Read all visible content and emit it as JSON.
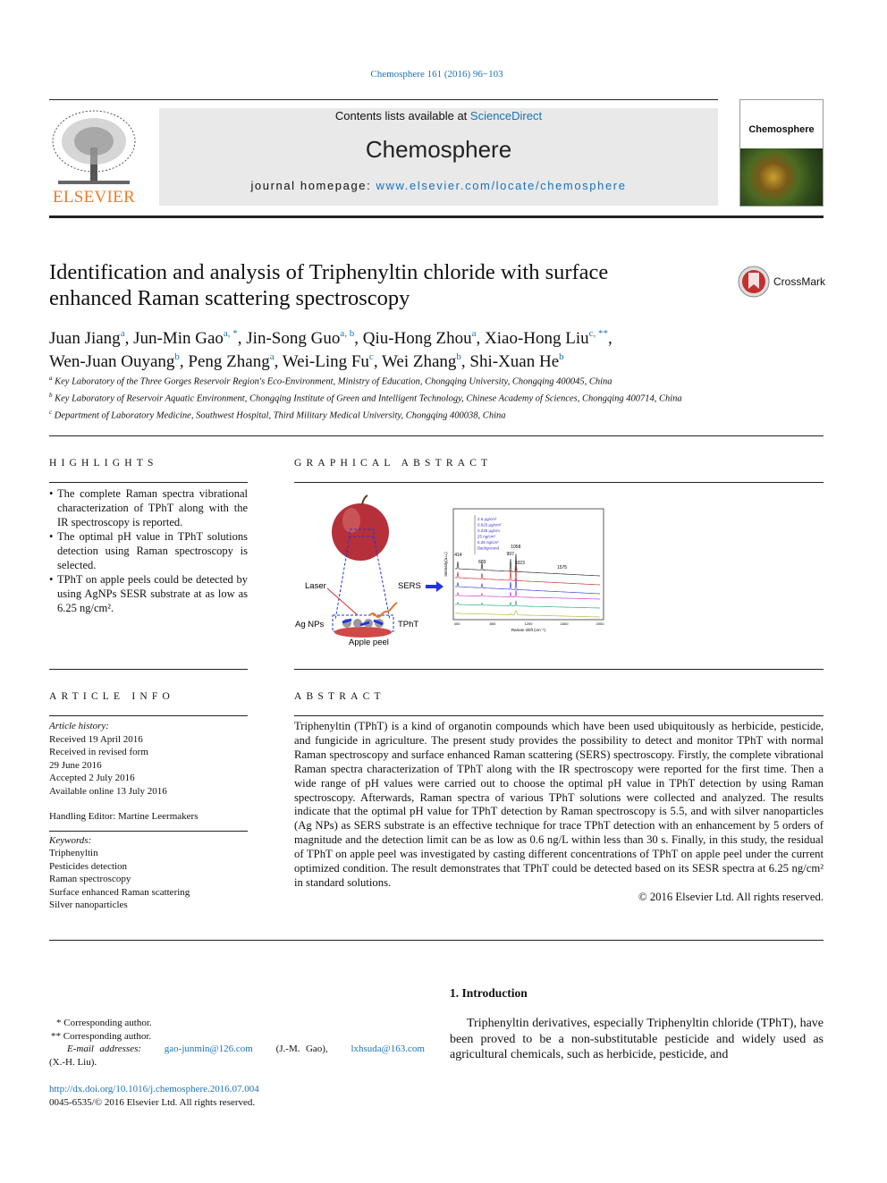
{
  "header": {
    "citation": "Chemosphere 161 (2016) 96−103",
    "contents_prefix": "Contents lists available at ",
    "contents_link": "ScienceDirect",
    "journal_title": "Chemosphere",
    "homepage_prefix": "journal homepage: ",
    "homepage_link": "www.elsevier.com/locate/chemosphere",
    "publisher": "ELSEVIER",
    "cover_title": "Chemosphere"
  },
  "crossmark": "CrossMark",
  "title": "Identification and analysis of Triphenyltin chloride with surface enhanced Raman scattering spectroscopy",
  "authors": [
    {
      "name": "Juan Jiang",
      "sup": "a"
    },
    {
      "name": "Jun-Min Gao",
      "sup": "a, *"
    },
    {
      "name": "Jin-Song Guo",
      "sup": "a, b"
    },
    {
      "name": "Qiu-Hong Zhou",
      "sup": "a"
    },
    {
      "name": "Xiao-Hong Liu",
      "sup": "c, **"
    },
    {
      "name": "Wen-Juan Ouyang",
      "sup": "b"
    },
    {
      "name": "Peng Zhang",
      "sup": "a"
    },
    {
      "name": "Wei-Ling Fu",
      "sup": "c"
    },
    {
      "name": "Wei Zhang",
      "sup": "b"
    },
    {
      "name": "Shi-Xuan He",
      "sup": "b"
    }
  ],
  "affiliations": [
    {
      "sup": "a",
      "text": "Key Laboratory of the Three Gorges Reservoir Region's Eco-Environment, Ministry of Education, Chongqing University, Chongqing 400045, China"
    },
    {
      "sup": "b",
      "text": "Key Laboratory of Reservoir Aquatic Environment, Chongqing Institute of Green and Intelligent Technology, Chinese Academy of Sciences, Chongqing 400714, China"
    },
    {
      "sup": "c",
      "text": "Department of Laboratory Medicine, Southwest Hospital, Third Military Medical University, Chongqing 400038, China"
    }
  ],
  "highlights": {
    "heading": "HIGHLIGHTS",
    "items": [
      "The complete Raman spectra vibrational characterization of TPhT along with the IR spectroscopy is reported.",
      "The optimal pH value in TPhT solutions detection using Raman spectroscopy is selected.",
      "TPhT on apple peels could be detected by using AgNPs SESR substrate at as low as 6.25 ng/cm²."
    ]
  },
  "graphical_abstract": {
    "heading": "GRAPHICAL ABSTRACT",
    "labels": {
      "laser": "Laser",
      "sers": "SERS",
      "agnps": "Ag NPs",
      "tpht": "TPhT",
      "peel": "Apple peel"
    },
    "spectrum": {
      "ylabel": "Intensity(a.u.)",
      "xlabel": "Raman shift (cm⁻¹)",
      "xticks": [
        "400",
        "800",
        "1200",
        "1600",
        "2000"
      ],
      "peaks": [
        "414",
        "683",
        "997",
        "1058",
        "1023",
        "1575"
      ],
      "legend": [
        "2.5 μg/cm²",
        "0.625 μg/cm²",
        "0.225 μg/cm",
        "25 ng/cm²",
        "6.25 ng/cm²",
        "Background"
      ],
      "colors": [
        "#333333",
        "#cc3333",
        "#4444dd",
        "#cc44cc",
        "#33aa88",
        "#bbbb44"
      ]
    }
  },
  "article_info": {
    "heading": "ARTICLE INFO",
    "history_label": "Article history:",
    "history": [
      "Received 19 April 2016",
      "Received in revised form",
      "29 June 2016",
      "Accepted 2 July 2016",
      "Available online 13 July 2016"
    ],
    "editor": "Handling Editor: Martine Leermakers",
    "keywords_label": "Keywords:",
    "keywords": [
      "Triphenyltin",
      "Pesticides detection",
      "Raman spectroscopy",
      "Surface enhanced Raman scattering",
      "Silver nanoparticles"
    ]
  },
  "abstract": {
    "heading": "ABSTRACT",
    "text": "Triphenyltin (TPhT) is a kind of organotin compounds which have been used ubiquitously as herbicide, pesticide, and fungicide in agriculture. The present study provides the possibility to detect and monitor TPhT with normal Raman spectroscopy and surface enhanced Raman scattering (SERS) spectroscopy. Firstly, the complete vibrational Raman spectra characterization of TPhT along with the IR spectroscopy were reported for the first time. Then a wide range of pH values were carried out to choose the optimal pH value in TPhT detection by using Raman spectroscopy. Afterwards, Raman spectra of various TPhT solutions were collected and analyzed. The results indicate that the optimal pH value for TPhT detection by Raman spectroscopy is 5.5, and with silver nanoparticles (Ag NPs) as SERS substrate is an effective technique for trace TPhT detection with an enhancement by 5 orders of magnitude and the detection limit can be as low as 0.6 ng/L within less than 30 s. Finally, in this study, the residual of TPhT on apple peel was investigated by casting different concentrations of TPhT on apple peel under the current optimized condition. The result demonstrates that TPhT could be detected based on its SESR spectra at 6.25 ng/cm² in standard solutions.",
    "copyright": "© 2016 Elsevier Ltd. All rights reserved."
  },
  "footnotes": {
    "corr1": "* Corresponding author.",
    "corr2": "** Corresponding author.",
    "email_label": "E-mail addresses:",
    "email1": "gao-junmin@126.com",
    "who1": "(J.-M. Gao),",
    "email2": "lxhsuda@163.com",
    "who2": "(X.-H. Liu)."
  },
  "doi": {
    "link": "http://dx.doi.org/10.1016/j.chemosphere.2016.07.004",
    "issn": "0045-6535/© 2016 Elsevier Ltd. All rights reserved."
  },
  "introduction": {
    "heading": "1.  Introduction",
    "text": "Triphenyltin derivatives, especially Triphenyltin chloride (TPhT), have been proved to be a non-substitutable pesticide and widely used as agricultural chemicals, such as herbicide, pesticide, and"
  }
}
